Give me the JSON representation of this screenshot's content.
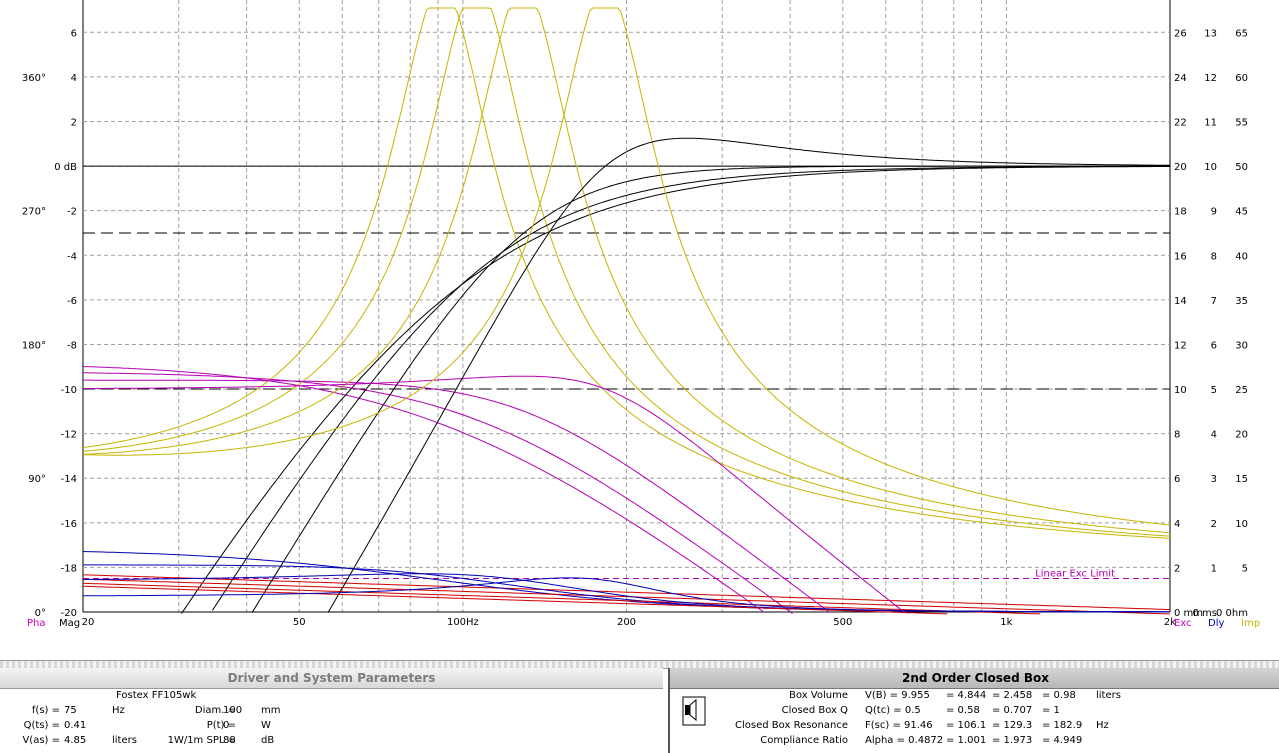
{
  "graph": {
    "left_axis_db": [
      "6",
      "4",
      "2",
      "0 dB",
      "-2",
      "-4",
      "-6",
      "-8",
      "-10",
      "-12",
      "-14",
      "-16",
      "-18",
      "-20"
    ],
    "left_axis_phase": [
      "360°",
      "270°",
      "180°",
      "90°",
      "0°"
    ],
    "right_axis_delay": [
      "26",
      "24",
      "22",
      "20",
      "18",
      "16",
      "14",
      "12",
      "10",
      "8",
      "6",
      "4",
      "2",
      "0 mm"
    ],
    "right_axis_ms": [
      "13",
      "12",
      "11",
      "10",
      "9",
      "8",
      "7",
      "6",
      "5",
      "4",
      "3",
      "2",
      "1",
      "0 ms"
    ],
    "right_axis_ohm": [
      "65",
      "60",
      "55",
      "50",
      "45",
      "40",
      "35",
      "30",
      "25",
      "20",
      "15",
      "10",
      "5",
      "0 0hm"
    ],
    "freq_labels": [
      "20",
      "50",
      "100Hz",
      "200",
      "500",
      "1k",
      "2k"
    ],
    "bottom_left_labels": [
      {
        "text": "Pha",
        "color": "#c800c8"
      },
      {
        "text": "Mag",
        "color": "#000000"
      }
    ],
    "bottom_right_labels": [
      {
        "text": "Exc",
        "color": "#c800c8"
      },
      {
        "text": "Dly",
        "color": "#0000c8"
      },
      {
        "text": "Imp",
        "color": "#c8b400"
      }
    ],
    "limit_label": "Linear Exc Limit",
    "colors": {
      "mag": "#000000",
      "imp": "#c8b400",
      "exc": "#b400b4",
      "dly": "#0000b4",
      "pha": "#d00000",
      "grid": "#a0a0a0"
    }
  },
  "chart_data": {
    "type": "line",
    "x_scale": "log",
    "xlim": [
      20,
      2000
    ],
    "ylim": [
      -20,
      7
    ],
    "ylabel": "dB",
    "reference_lines_db": [
      0,
      -3,
      -10
    ],
    "excursion_limit_db": -18.5,
    "systems": [
      {
        "fsc": 91.46,
        "qtc": 0.5
      },
      {
        "fsc": 106.1,
        "qtc": 0.58
      },
      {
        "fsc": 129.3,
        "qtc": 0.707
      },
      {
        "fsc": 182.9,
        "qtc": 1.0
      }
    ]
  },
  "left_panel": {
    "title": "Driver and System Parameters",
    "driver_name": "Fostex  FF105wk",
    "rows": [
      {
        "param": "f(s) =",
        "value": "75",
        "unit": "Hz",
        "param2": "Diam. =",
        "value2": "100",
        "unit2": "mm"
      },
      {
        "param": "Q(ts) =",
        "value": "0.41",
        "unit": "",
        "param2": "P(t) =",
        "value2": "0",
        "unit2": "W"
      },
      {
        "param": "V(as) =",
        "value": "4.85",
        "unit": "liters",
        "param2": "1W/1m SPL =",
        "value2": "88",
        "unit2": "dB"
      }
    ]
  },
  "right_panel": {
    "title": "2nd Order Closed Box",
    "rows": [
      {
        "label": "Box Volume",
        "sym": "V(B) = 9.955",
        "v2": "= 4.844",
        "v3": "= 2.458",
        "v4": "= 0.98",
        "unit": "liters"
      },
      {
        "label": "Closed Box Q",
        "sym": "Q(tc) = 0.5",
        "v2": "= 0.58",
        "v3": "= 0.707",
        "v4": "= 1",
        "unit": ""
      },
      {
        "label": "Closed Box Resonance",
        "sym": "F(sc) = 91.46",
        "v2": "= 106.1",
        "v3": "= 129.3",
        "v4": "= 182.9",
        "unit": "Hz"
      },
      {
        "label": "Compliance Ratio",
        "sym": "Alpha = 0.4872",
        "v2": "= 1.001",
        "v3": "= 1.973",
        "v4": "= 4.949",
        "unit": ""
      }
    ]
  }
}
